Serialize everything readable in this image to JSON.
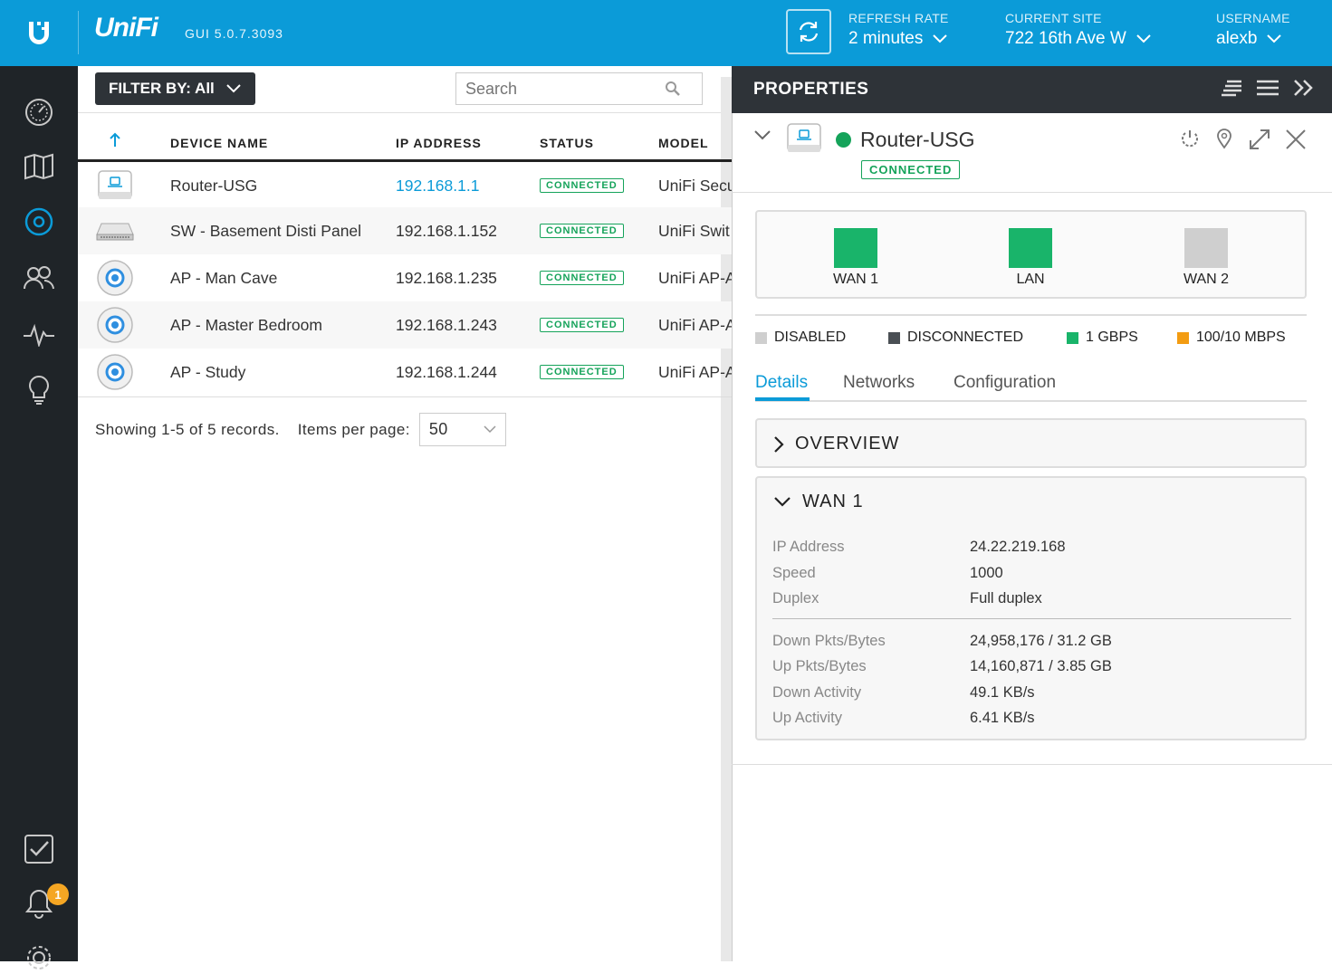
{
  "header": {
    "brand": "UniFi",
    "version": "GUI 5.0.7.3093",
    "refresh_label": "REFRESH RATE",
    "refresh_value": "2 minutes",
    "site_label": "CURRENT SITE",
    "site_value": "722 16th Ave W",
    "user_label": "USERNAME",
    "user_value": "alexb"
  },
  "sidebar": {
    "notification_count": "1",
    "items": [
      "dashboard-icon",
      "map-icon",
      "devices-icon",
      "clients-icon",
      "statistics-icon",
      "insights-icon",
      "events-icon",
      "alerts-icon",
      "settings-icon"
    ]
  },
  "toolbar": {
    "filter_label": "FILTER BY: All",
    "search_placeholder": "Search"
  },
  "table": {
    "columns": [
      "DEVICE NAME",
      "IP ADDRESS",
      "STATUS",
      "MODEL"
    ],
    "rows": [
      {
        "name": "Router-USG",
        "ip": "192.168.1.1",
        "status": "CONNECTED",
        "model": "UniFi Secu",
        "icon": "router-icon"
      },
      {
        "name": "SW - Basement Disti Panel",
        "ip": "192.168.1.152",
        "status": "CONNECTED",
        "model": "UniFi Swit",
        "icon": "switch-icon"
      },
      {
        "name": "AP - Man Cave",
        "ip": "192.168.1.235",
        "status": "CONNECTED",
        "model": "UniFi AP-A",
        "icon": "access-point-icon"
      },
      {
        "name": "AP - Master Bedroom",
        "ip": "192.168.1.243",
        "status": "CONNECTED",
        "model": "UniFi AP-A",
        "icon": "access-point-icon"
      },
      {
        "name": "AP - Study",
        "ip": "192.168.1.244",
        "status": "CONNECTED",
        "model": "UniFi AP-A",
        "icon": "access-point-icon"
      }
    ]
  },
  "pager": {
    "showing": "Showing 1-5 of 5 records.",
    "items_label": "Items per page:",
    "items_value": "50"
  },
  "properties": {
    "title": "PROPERTIES",
    "device_name": "Router-USG",
    "device_status": "CONNECTED",
    "ports": [
      {
        "label": "WAN 1",
        "color": "#19b46a"
      },
      {
        "label": "LAN",
        "color": "#19b46a"
      },
      {
        "label": "WAN 2",
        "color": "#cfcfcf"
      }
    ],
    "legend": [
      {
        "label": "DISABLED",
        "color": "#cfcfcf"
      },
      {
        "label": "DISCONNECTED",
        "color": "#4a4f54"
      },
      {
        "label": "1 GBPS",
        "color": "#19b46a"
      },
      {
        "label": "100/10 MBPS",
        "color": "#f39c12"
      }
    ],
    "tabs": [
      "Details",
      "Networks",
      "Configuration"
    ],
    "overview_title": "OVERVIEW",
    "wan_title": "WAN 1",
    "wan_fields": [
      {
        "k": "IP Address",
        "v": "24.22.219.168"
      },
      {
        "k": "Speed",
        "v": "1000"
      },
      {
        "k": "Duplex",
        "v": "Full duplex"
      },
      {
        "k": "Down Pkts/Bytes",
        "v": "24,958,176 / 31.2 GB"
      },
      {
        "k": "Up Pkts/Bytes",
        "v": "14,160,871 / 3.85 GB"
      },
      {
        "k": "Down Activity",
        "v": "49.1 KB/s"
      },
      {
        "k": "Up Activity",
        "v": "6.41 KB/s"
      }
    ]
  },
  "colors": {
    "accent": "#0b9bd8",
    "connected": "#15a35a",
    "sidebar": "#1f2428",
    "badge": "#f5a623"
  }
}
